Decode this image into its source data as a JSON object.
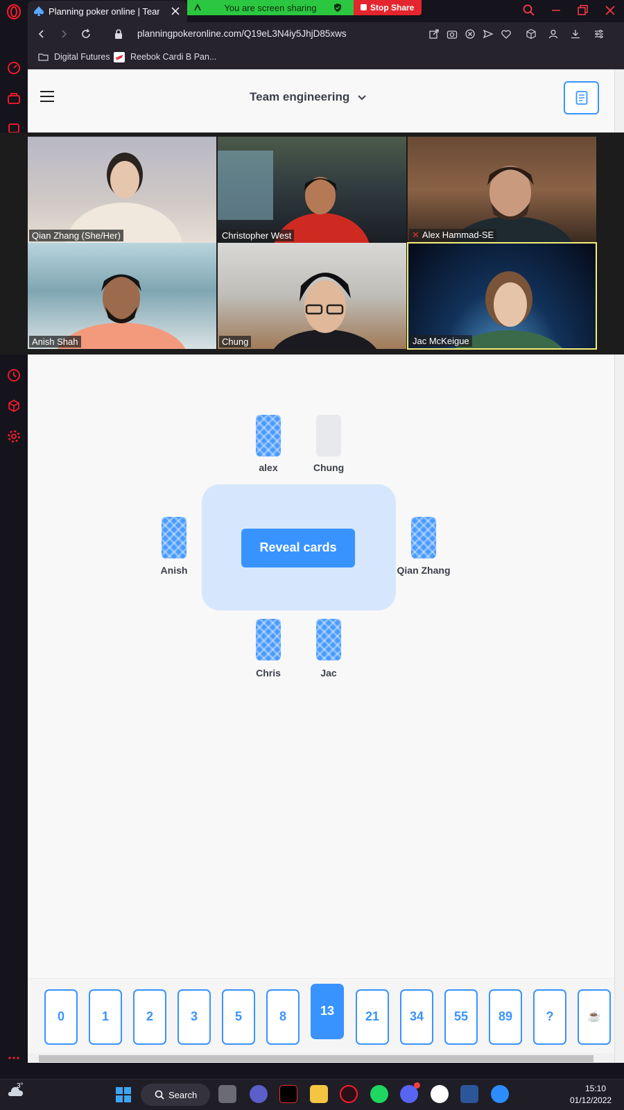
{
  "browser": {
    "tab_title": "Planning poker online | Team",
    "url": "planningpokeronline.com/Q19eL3N4iy5JhjD85xws",
    "bookmarks": [
      "Digital Futures",
      "Reebok Cardi B Pan..."
    ],
    "screen_share": {
      "status": "You are screen sharing",
      "stop_label": "Stop Share"
    }
  },
  "app": {
    "game_title": "Team engineering"
  },
  "video_gallery": {
    "participants": [
      {
        "name": "Qian Zhang (She/Her)",
        "muted": false,
        "active_speaker": false
      },
      {
        "name": "Christopher West",
        "muted": false,
        "active_speaker": false
      },
      {
        "name": "Alex Hammad-SE",
        "muted": true,
        "active_speaker": false
      },
      {
        "name": "Anish Shah",
        "muted": false,
        "active_speaker": false
      },
      {
        "name": "Chung",
        "muted": false,
        "active_speaker": false
      },
      {
        "name": "Jac McKeigue",
        "muted": false,
        "active_speaker": true
      }
    ]
  },
  "table": {
    "reveal_label": "Reveal cards",
    "players": [
      {
        "name": "alex",
        "card": "voted"
      },
      {
        "name": "Chung",
        "card": "not-voted"
      },
      {
        "name": "Anish",
        "card": "voted"
      },
      {
        "name": "Qian Zhang",
        "card": "voted"
      },
      {
        "name": "Chris",
        "card": "voted"
      },
      {
        "name": "Jac",
        "card": "voted"
      }
    ]
  },
  "deck": {
    "cards": [
      "0",
      "1",
      "2",
      "3",
      "5",
      "8",
      "13",
      "21",
      "34",
      "55",
      "89",
      "?",
      "☕"
    ],
    "selected": "13"
  },
  "taskbar": {
    "search_label": "Search",
    "time": "15:10",
    "date": "01/12/2022",
    "weather": "3°"
  },
  "colors": {
    "accent": "#3993ff",
    "share_green": "#2cc740",
    "stop_red": "#e3262d",
    "opera_red": "#ff1b2d"
  }
}
